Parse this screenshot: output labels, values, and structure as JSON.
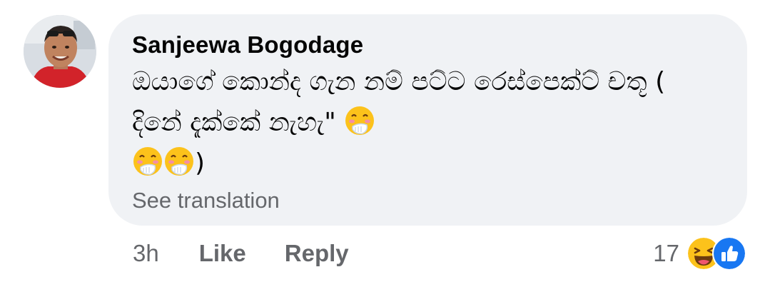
{
  "comment": {
    "author": "Sanjeewa Bogodage",
    "body": "ඔයාගේ කොන්ද ගැන නම් පට්ට රෙස්පෙක්ට් චතූ ( දිනේ දැක්කේ නැහැ\" ",
    "body_emoji": "face-with-hand-over-mouth-icon",
    "closing": ")",
    "see_translation": "See translation"
  },
  "actions": {
    "time": "3h",
    "like_label": "Like",
    "reply_label": "Reply"
  },
  "reactions": {
    "count": "17",
    "types": [
      "haha-reaction-icon",
      "like-reaction-icon"
    ]
  },
  "colors": {
    "bubble": "#f0f2f5",
    "text": "#050505",
    "secondary": "#65676b",
    "like_blue": "#1877f2",
    "emoji_yellow": "#fcc21b"
  }
}
